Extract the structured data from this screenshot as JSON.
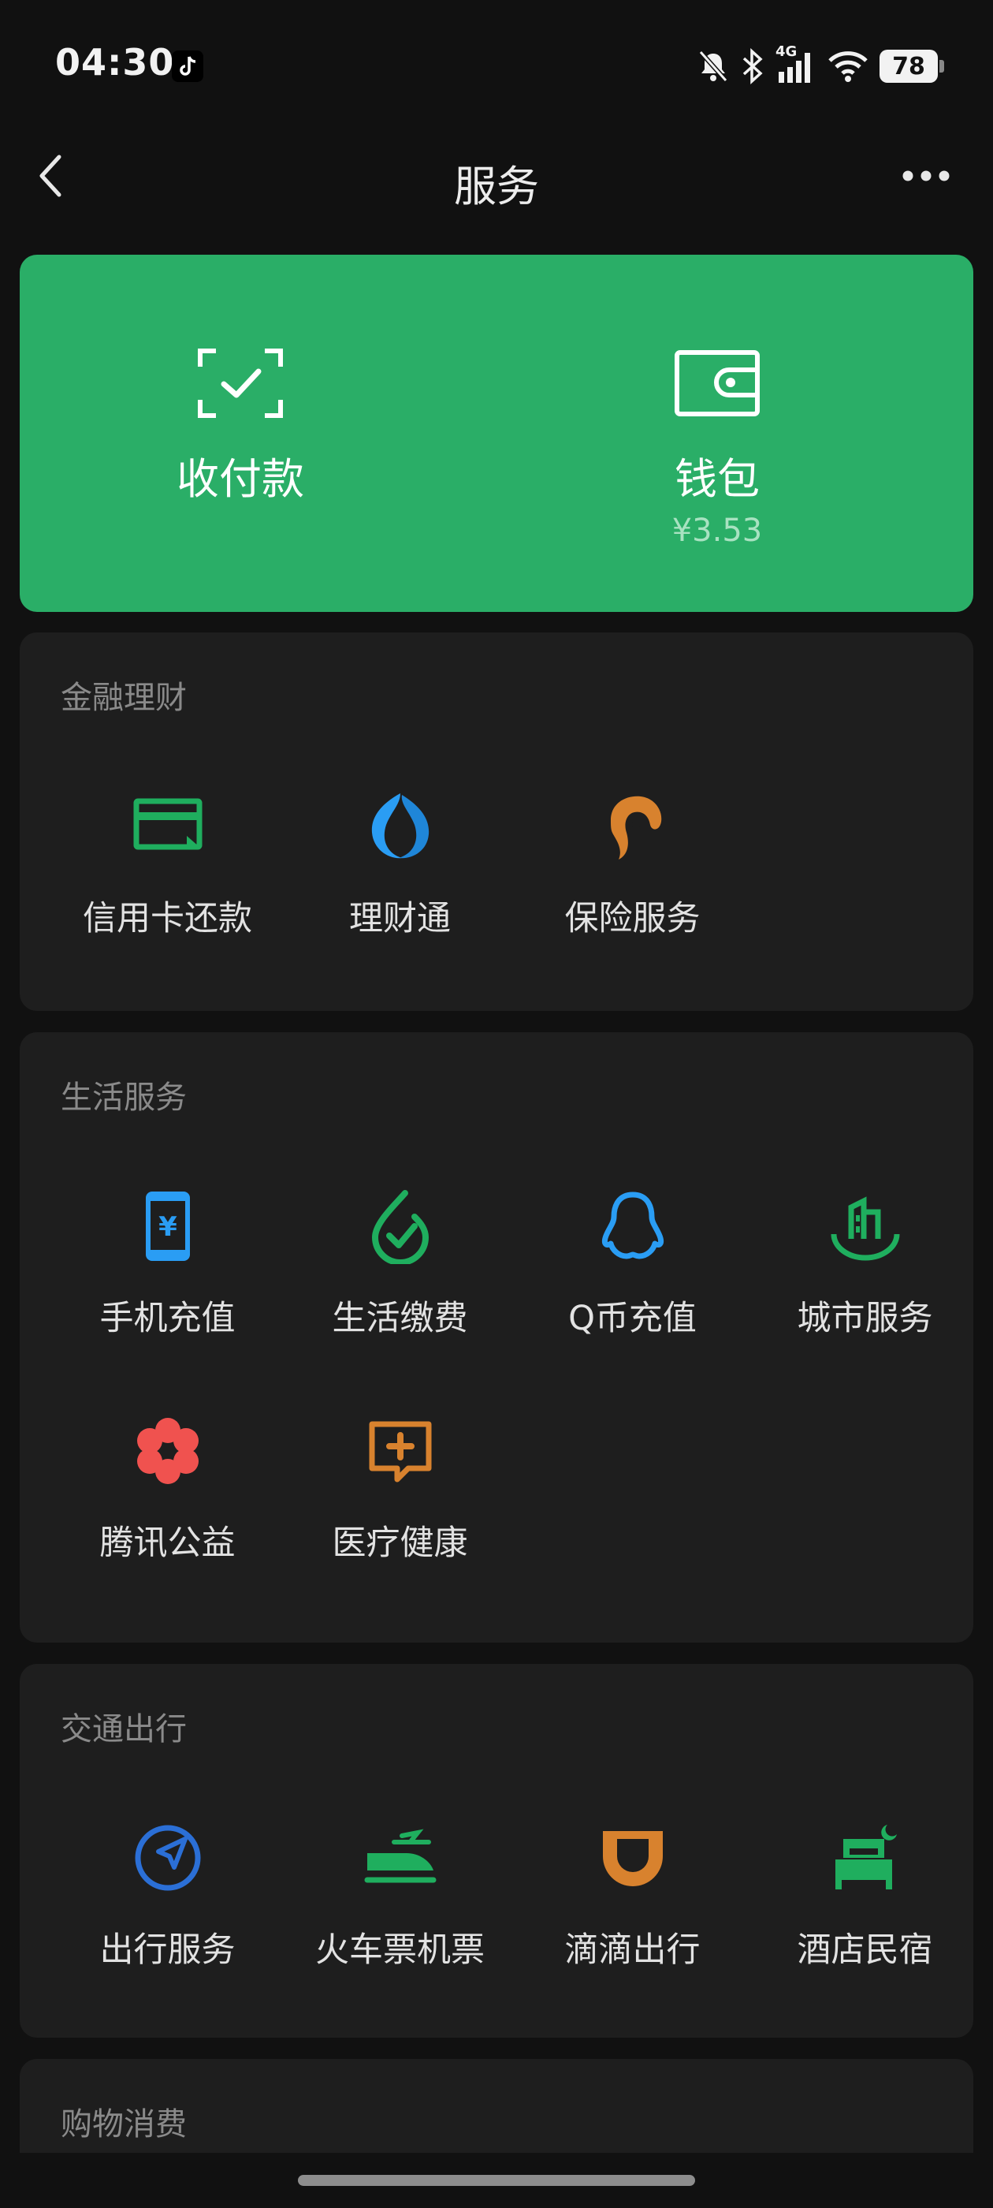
{
  "status_bar": {
    "time": "04:30",
    "network": "4G",
    "battery": "78",
    "icons": [
      "tiktok-icon",
      "mute-bell-icon",
      "bluetooth-icon",
      "signal-icon",
      "wifi-icon",
      "battery-icon"
    ]
  },
  "nav": {
    "title": "服务",
    "back_icon": "chevron-left-icon",
    "more_icon": "more-dots-icon"
  },
  "pay_card": {
    "background": "#2aae67",
    "pay": {
      "label": "收付款",
      "icon": "scan-check-icon"
    },
    "wallet": {
      "label": "钱包",
      "balance": "¥3.53",
      "icon": "wallet-icon"
    }
  },
  "sections": {
    "finance": {
      "title": "金融理财",
      "items": [
        {
          "label": "信用卡还款",
          "icon": "credit-card-icon",
          "color": "#1fae5e"
        },
        {
          "label": "理财通",
          "icon": "licaitong-icon",
          "color": "#2a9df4"
        },
        {
          "label": "保险服务",
          "icon": "insurance-icon",
          "color": "#d8822e"
        }
      ]
    },
    "life": {
      "title": "生活服务",
      "items": [
        {
          "label": "手机充值",
          "icon": "phone-topup-icon",
          "color": "#2a9df4"
        },
        {
          "label": "生活缴费",
          "icon": "utility-bill-icon",
          "color": "#1fae5e"
        },
        {
          "label": "Q币充值",
          "icon": "qq-penguin-icon",
          "color": "#2a9df4"
        },
        {
          "label": "城市服务",
          "icon": "city-service-icon",
          "color": "#1fae5e"
        },
        {
          "label": "腾讯公益",
          "icon": "charity-flower-icon",
          "color": "#f0524f"
        },
        {
          "label": "医疗健康",
          "icon": "medical-icon",
          "color": "#d8822e"
        }
      ]
    },
    "travel": {
      "title": "交通出行",
      "items": [
        {
          "label": "出行服务",
          "icon": "navigation-icon",
          "color": "#2b6fd6"
        },
        {
          "label": "火车票机票",
          "icon": "train-plane-icon",
          "color": "#1fae5e"
        },
        {
          "label": "滴滴出行",
          "icon": "didi-icon",
          "color": "#d8822e"
        },
        {
          "label": "酒店民宿",
          "icon": "hotel-bed-icon",
          "color": "#1fae5e"
        }
      ]
    },
    "shopping": {
      "title": "购物消费"
    }
  }
}
